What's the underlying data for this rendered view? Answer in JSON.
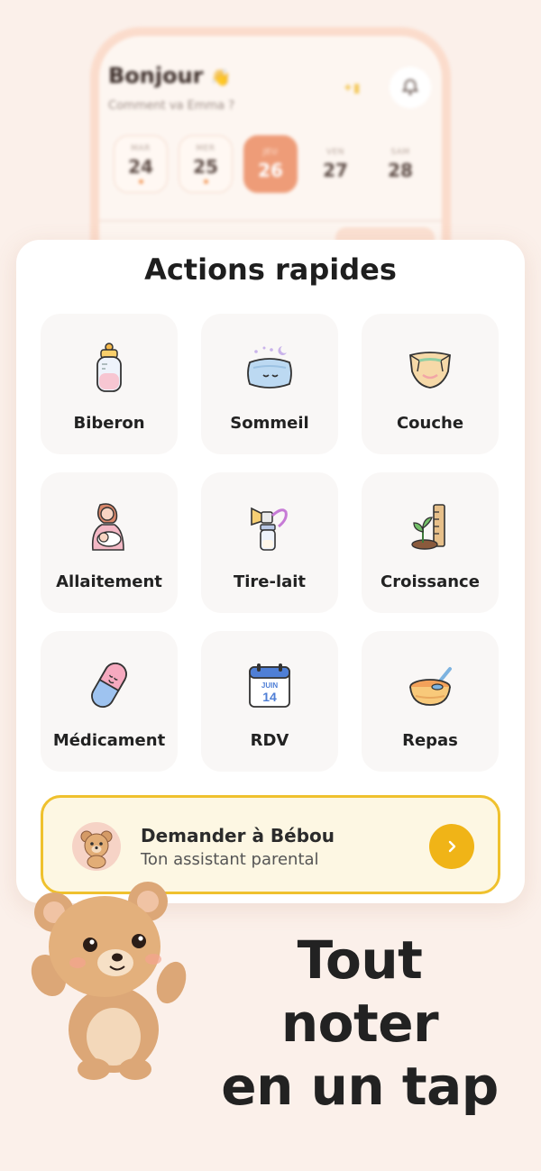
{
  "preview": {
    "greeting": "Bonjour",
    "greeting_emoji": "👋",
    "subtitle": "Comment va Emma ?",
    "days": [
      {
        "name": "MAR",
        "num": "24",
        "state": "logged"
      },
      {
        "name": "MER",
        "num": "25",
        "state": "logged"
      },
      {
        "name": "JEU",
        "num": "26",
        "state": "today"
      },
      {
        "name": "VEN",
        "num": "27",
        "state": "plain"
      },
      {
        "name": "SAM",
        "num": "28",
        "state": "plain"
      }
    ]
  },
  "quick_actions": {
    "title": "Actions rapides",
    "items": [
      {
        "label": "Biberon",
        "icon": "baby-bottle-icon"
      },
      {
        "label": "Sommeil",
        "icon": "pillow-icon"
      },
      {
        "label": "Couche",
        "icon": "diaper-icon"
      },
      {
        "label": "Allaitement",
        "icon": "breastfeeding-icon"
      },
      {
        "label": "Tire-lait",
        "icon": "breast-pump-icon"
      },
      {
        "label": "Croissance",
        "icon": "growth-ruler-icon"
      },
      {
        "label": "Médicament",
        "icon": "pill-icon"
      },
      {
        "label": "RDV",
        "icon": "calendar-icon"
      },
      {
        "label": "Repas",
        "icon": "food-bowl-icon"
      }
    ],
    "calendar_icon_text": {
      "month": "JUIN",
      "day": "14"
    }
  },
  "assistant": {
    "title": "Demander à Bébou",
    "subtitle": "Ton assistant parental",
    "icon": "teddy-bear-avatar-icon"
  },
  "headline": {
    "line1": "Tout noter",
    "line2": "en un tap"
  },
  "colors": {
    "background": "#fbf0ea",
    "accent_yellow": "#f0b417",
    "today_orange": "#ee9c78"
  }
}
